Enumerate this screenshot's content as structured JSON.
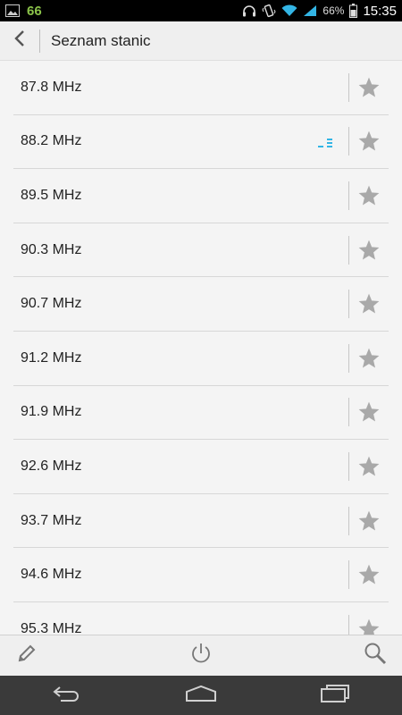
{
  "status_bar": {
    "notification_count": "66",
    "battery": "66%",
    "time": "15:35"
  },
  "action_bar": {
    "title": "Seznam stanic"
  },
  "stations": [
    {
      "frequency": "87.8 MHz",
      "playing": false
    },
    {
      "frequency": "88.2 MHz",
      "playing": true
    },
    {
      "frequency": "89.5 MHz",
      "playing": false
    },
    {
      "frequency": "90.3 MHz",
      "playing": false
    },
    {
      "frequency": "90.7 MHz",
      "playing": false
    },
    {
      "frequency": "91.2 MHz",
      "playing": false
    },
    {
      "frequency": "91.9 MHz",
      "playing": false
    },
    {
      "frequency": "92.6 MHz",
      "playing": false
    },
    {
      "frequency": "93.7 MHz",
      "playing": false
    },
    {
      "frequency": "94.6 MHz",
      "playing": false
    },
    {
      "frequency": "95.3 MHz",
      "playing": false
    }
  ],
  "colors": {
    "accent": "#33b5e5",
    "icon_gray": "#a9a9a9",
    "notification_green": "#8bc34a"
  }
}
